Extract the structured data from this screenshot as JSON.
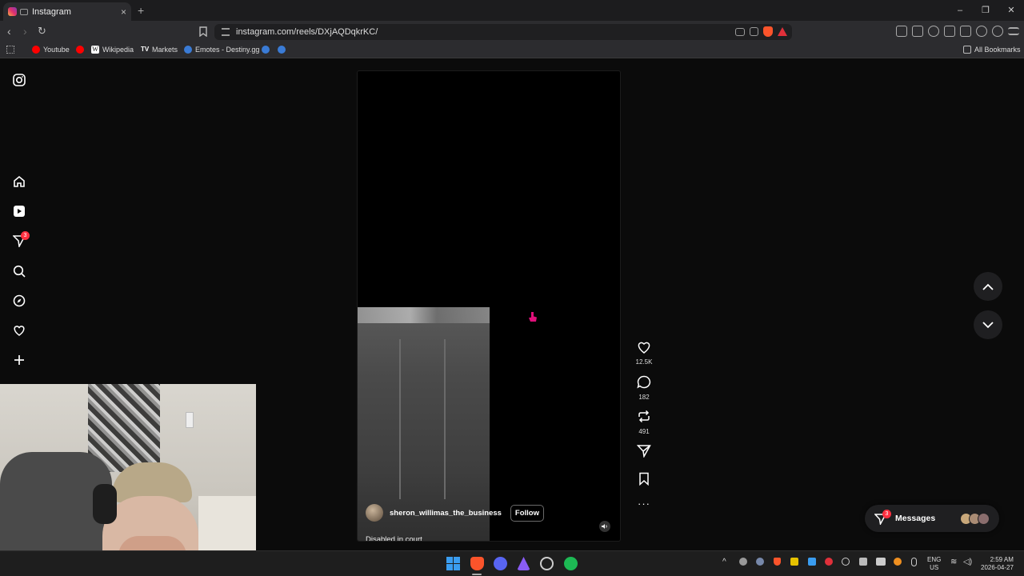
{
  "browser": {
    "tab_title": "Instagram",
    "tab_close": "×",
    "new_tab": "+",
    "window_controls": [
      "–",
      "❐",
      "✕"
    ],
    "url": "instagram.com/reels/DXjAQDqkrKC/",
    "bookmarks": [
      {
        "label": "Youtube",
        "icon": "youtube-icon",
        "color": "#ff0000"
      },
      {
        "label": "",
        "icon": "youtube-icon",
        "color": "#ff0000"
      },
      {
        "label": "Wikipedia",
        "icon": "wikipedia-icon",
        "color": "#ffffff"
      },
      {
        "label": "Markets",
        "icon": "tradingview-icon",
        "color": "#ffffff"
      },
      {
        "label": "Emotes - Destiny.gg",
        "icon": "destiny-icon",
        "color": "#3a7bd5"
      }
    ],
    "all_bookmarks": "All Bookmarks"
  },
  "sidebar": {
    "icons": [
      "instagram-logo-icon",
      "home-icon",
      "reels-icon",
      "direct-icon",
      "search-icon",
      "explore-icon",
      "heart-icon",
      "create-icon"
    ],
    "direct_badge": "3"
  },
  "reel": {
    "username": "sheron_willimas_the_business",
    "follow_label": "Follow",
    "caption": "Disabled in court",
    "likes": "12.5K",
    "comments": "182",
    "reposts": "491"
  },
  "messages": {
    "label": "Messages",
    "badge": "3"
  },
  "taskbar": {
    "lang_top": "ENG",
    "lang_bottom": "US",
    "time": "2:59 AM",
    "date": "2026-04-27"
  },
  "colors": {
    "accent_red": "#ff3040",
    "brave_orange": "#fb542b",
    "spotify_green": "#1db954",
    "discord_blurple": "#5865f2"
  }
}
